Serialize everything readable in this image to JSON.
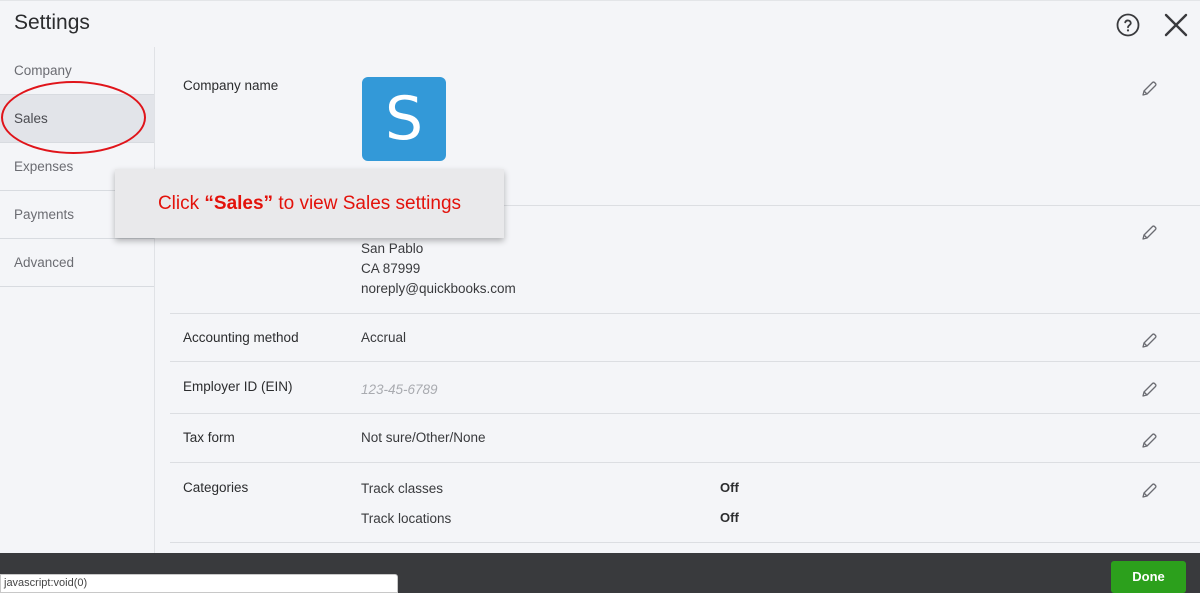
{
  "header": {
    "title": "Settings",
    "help_icon": "help-icon",
    "close_icon": "close-icon"
  },
  "sidebar": {
    "items": [
      {
        "label": "Company"
      },
      {
        "label": "Sales",
        "active": true
      },
      {
        "label": "Expenses"
      },
      {
        "label": "Payments"
      },
      {
        "label": "Advanced"
      }
    ]
  },
  "company": {
    "company_name_label": "Company name",
    "logo_letter": "S",
    "address_lines": [
      "San Pablo",
      "CA 87999",
      "noreply@quickbooks.com"
    ]
  },
  "accounting": {
    "label": "Accounting method",
    "value": "Accrual"
  },
  "employer_id": {
    "label": "Employer ID (EIN)",
    "placeholder": "123-45-6789"
  },
  "tax_form": {
    "label": "Tax form",
    "value": "Not sure/Other/None"
  },
  "categories": {
    "label": "Categories",
    "items": [
      {
        "name": "Track classes",
        "value": "Off"
      },
      {
        "name": "Track locations",
        "value": "Off"
      }
    ]
  },
  "tooltip": {
    "prefix": "Click ",
    "highlight": "“Sales”",
    "suffix": " to view Sales settings"
  },
  "footer": {
    "status_text": "javascript:void(0)",
    "done_label": "Done"
  },
  "colors": {
    "accent_green": "#2ca01c",
    "logo_blue": "#3399d8",
    "annotation_red": "#e3120b"
  }
}
